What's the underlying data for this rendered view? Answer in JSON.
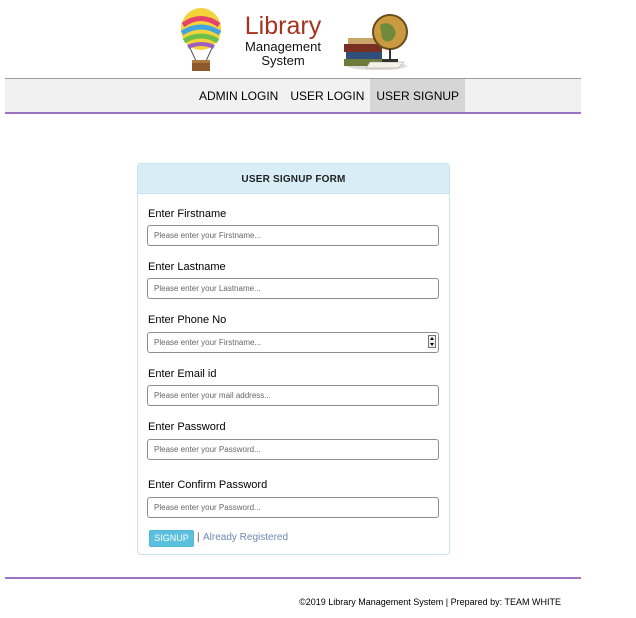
{
  "logo": {
    "title": "Library",
    "subtitle_line1": "Management",
    "subtitle_line2": "System",
    "left_icon": "balloon-icon",
    "right_icon": "globe-books-icon"
  },
  "nav": {
    "items": [
      {
        "label": "ADMIN LOGIN",
        "active": false
      },
      {
        "label": "USER LOGIN",
        "active": false
      },
      {
        "label": "USER SIGNUP",
        "active": true
      }
    ]
  },
  "form": {
    "title": "USER SIGNUP FORM",
    "fields": {
      "firstname": {
        "label": "Enter Firstname",
        "placeholder": "Please enter your Firstname...",
        "value": ""
      },
      "lastname": {
        "label": "Enter Lastname",
        "placeholder": "Please enter your Lastname...",
        "value": ""
      },
      "phone": {
        "label": "Enter Phone No",
        "placeholder": "Please enter your Firstname...",
        "value": ""
      },
      "email": {
        "label": "Enter Email id",
        "placeholder": "Please enter your mail address...",
        "value": ""
      },
      "password": {
        "label": "Enter Password",
        "placeholder": "Please enter your Password...",
        "value": ""
      },
      "confirm_password": {
        "label": "Enter Confirm Password",
        "placeholder": "Please enter your Password...",
        "value": ""
      }
    },
    "submit_label": "SIGNUP",
    "separator": "|",
    "already_link": "Already Registered"
  },
  "footer": {
    "text": "©2019 Library Management System | Prepared by: TEAM WHITE"
  },
  "colors": {
    "brand": "#a5331f",
    "accent_line": "#9b74c4",
    "panel_head": "#d9edf7",
    "button": "#5bc0de",
    "link": "#6f88b5"
  }
}
